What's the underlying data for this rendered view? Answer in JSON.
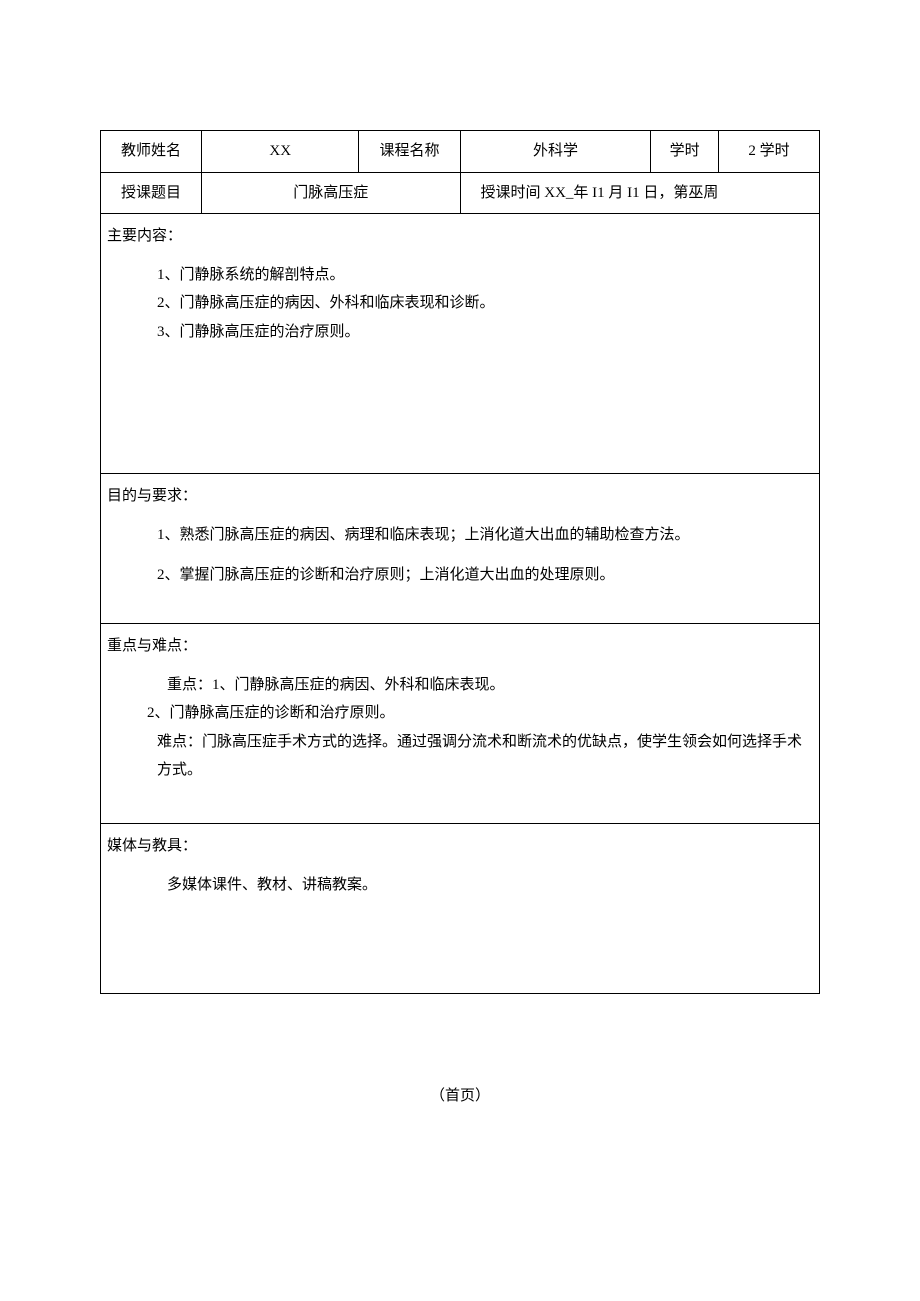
{
  "header": {
    "teacher_name_label": "教师姓名",
    "teacher_name_value": "XX",
    "course_name_label": "课程名称",
    "course_name_value": "外科学",
    "hours_label": "学时",
    "hours_value": "2 学时",
    "topic_label": "授课题目",
    "topic_value": "门脉高压症",
    "time_text": "授课时间 XX_年 I1 月 I1 日，第巫周"
  },
  "main_content": {
    "title": "主要内容：",
    "item1": "1、门静脉系统的解剖特点。",
    "item2": "2、门静脉高压症的病因、外科和临床表现和诊断。",
    "item3": "3、门静脉高压症的治疗原则。"
  },
  "objectives": {
    "title": "目的与要求：",
    "item1": "1、熟悉门脉高压症的病因、病理和临床表现；上消化道大出血的辅助检查方法。",
    "item2": "2、掌握门脉高压症的诊断和治疗原则；上消化道大出血的处理原则。"
  },
  "keypoints": {
    "title": "重点与难点：",
    "line1": "重点：1、门静脉高压症的病因、外科和临床表现。",
    "line2": "2、门静脉高压症的诊断和治疗原则。",
    "line3": "难点：门脉高压症手术方式的选择。通过强调分流术和断流术的优缺点，使学生领会如何选择手术方式。"
  },
  "media": {
    "title": "媒体与教具：",
    "text": "多媒体课件、教材、讲稿教案。"
  },
  "footer": "（首页）"
}
